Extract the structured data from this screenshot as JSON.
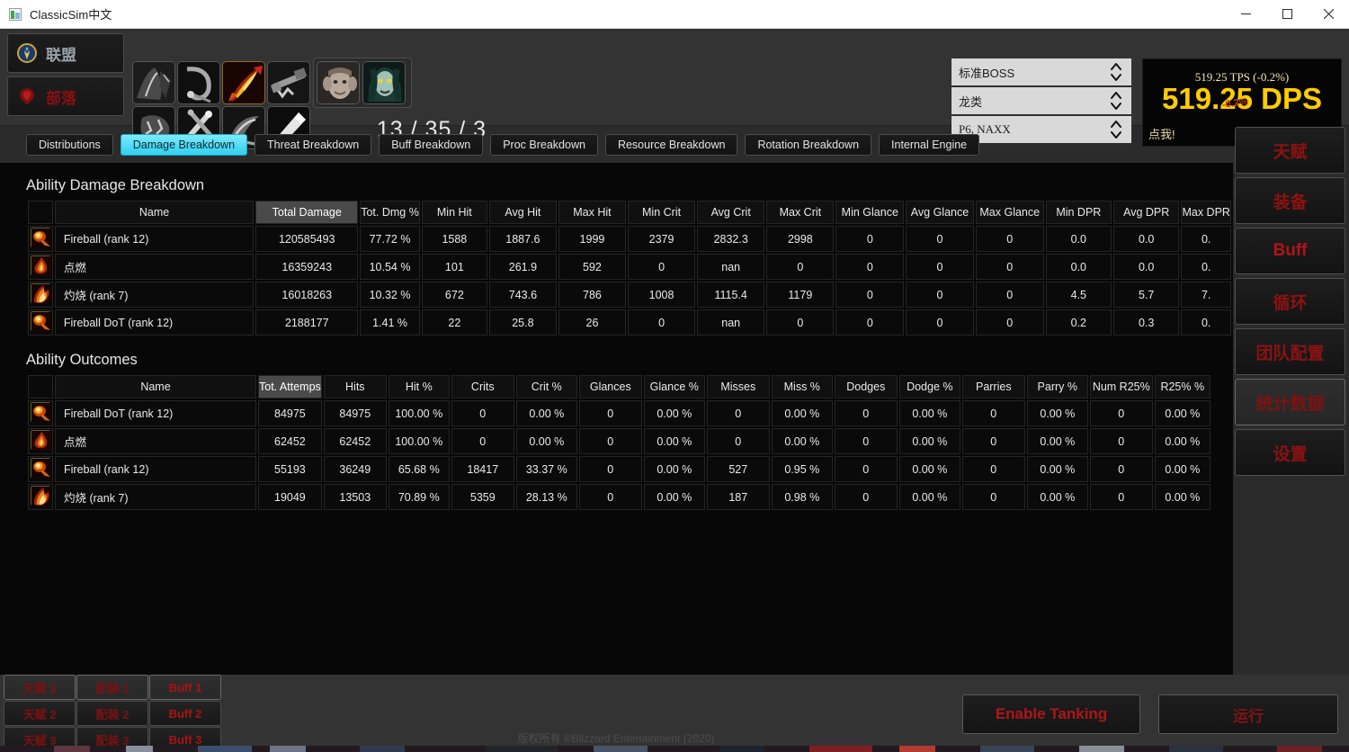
{
  "window": {
    "title": "ClassicSim中文",
    "app_icon": "app-window-icon",
    "minimize": "minimize-icon",
    "maximize": "maximize-icon",
    "close": "close-icon"
  },
  "header": {
    "factions": [
      {
        "label": "联盟",
        "icon": "alliance-crest-icon",
        "selected": false
      },
      {
        "label": "部落",
        "icon": "horde-crest-icon",
        "selected": false
      }
    ],
    "classes": [
      {
        "name": "class-icon-druid",
        "selected": false
      },
      {
        "name": "class-icon-priest",
        "selected": false
      },
      {
        "name": "class-icon-mage",
        "selected": true
      },
      {
        "name": "class-icon-hunter",
        "selected": false
      },
      {
        "name": "class-icon-shaman",
        "selected": false
      },
      {
        "name": "class-icon-rogue",
        "selected": false
      },
      {
        "name": "class-icon-warlock",
        "selected": false
      },
      {
        "name": "class-icon-warrior",
        "selected": false
      }
    ],
    "races": [
      {
        "name": "race-icon-gnome",
        "selected": false
      },
      {
        "name": "race-icon-undead",
        "selected": false
      }
    ],
    "talent_points": "13 / 35 / 3",
    "dropdowns": [
      {
        "name": "boss-select",
        "value": "标准BOSS"
      },
      {
        "name": "creature-type-select",
        "value": "龙类"
      },
      {
        "name": "phase-select",
        "value": "P6, NAXX"
      }
    ],
    "dps_panel": {
      "tps": "519.25 TPS (-0.2%)",
      "dps": "519.25 DPS",
      "dps_overlay": "-0.2%",
      "click_hint": "点我!",
      "accent": "#ffcc00"
    }
  },
  "tabs": [
    {
      "label": "Distributions",
      "active": false
    },
    {
      "label": "Damage Breakdown",
      "active": true
    },
    {
      "label": "Threat Breakdown",
      "active": false
    },
    {
      "label": "Buff Breakdown",
      "active": false
    },
    {
      "label": "Proc Breakdown",
      "active": false
    },
    {
      "label": "Resource Breakdown",
      "active": false
    },
    {
      "label": "Rotation Breakdown",
      "active": false
    },
    {
      "label": "Internal Engine",
      "active": false
    }
  ],
  "damage_breakdown": {
    "title": "Ability Damage Breakdown",
    "sorted_column": "Total Damage",
    "columns": [
      "",
      "Name",
      "Total Damage",
      "Tot. Dmg %",
      "Min Hit",
      "Avg Hit",
      "Max Hit",
      "Min Crit",
      "Avg Crit",
      "Max Crit",
      "Min Glance",
      "Avg Glance",
      "Max Glance",
      "Min DPR",
      "Avg DPR",
      "Max DPR"
    ],
    "rows": [
      {
        "icon": "ability-icon-fireball",
        "cells": [
          "Fireball (rank 12)",
          "120585493",
          "77.72 %",
          "1588",
          "1887.6",
          "1999",
          "2379",
          "2832.3",
          "2998",
          "0",
          "0",
          "0",
          "0.0",
          "0.0",
          "0."
        ]
      },
      {
        "icon": "ability-icon-ignite",
        "cells": [
          "点燃",
          "16359243",
          "10.54 %",
          "101",
          "261.9",
          "592",
          "0",
          "nan",
          "0",
          "0",
          "0",
          "0",
          "0.0",
          "0.0",
          "0."
        ]
      },
      {
        "icon": "ability-icon-scorch",
        "cells": [
          "灼烧 (rank 7)",
          "16018263",
          "10.32 %",
          "672",
          "743.6",
          "786",
          "1008",
          "1115.4",
          "1179",
          "0",
          "0",
          "0",
          "4.5",
          "5.7",
          "7."
        ]
      },
      {
        "icon": "ability-icon-fireball-dot",
        "cells": [
          "Fireball DoT (rank 12)",
          "2188177",
          "1.41 %",
          "22",
          "25.8",
          "26",
          "0",
          "nan",
          "0",
          "0",
          "0",
          "0",
          "0.2",
          "0.3",
          "0."
        ]
      }
    ]
  },
  "ability_outcomes": {
    "title": "Ability Outcomes",
    "sorted_column": "Tot. Attemps",
    "columns": [
      "",
      "Name",
      "Tot. Attemps",
      "Hits",
      "Hit %",
      "Crits",
      "Crit %",
      "Glances",
      "Glance %",
      "Misses",
      "Miss %",
      "Dodges",
      "Dodge %",
      "Parries",
      "Parry %",
      "Num R25%",
      "R25% %"
    ],
    "rows": [
      {
        "icon": "ability-icon-fireball-dot",
        "cells": [
          "Fireball DoT (rank 12)",
          "84975",
          "84975",
          "100.00 %",
          "0",
          "0.00 %",
          "0",
          "0.00 %",
          "0",
          "0.00 %",
          "0",
          "0.00 %",
          "0",
          "0.00 %",
          "0",
          "0.00 %"
        ]
      },
      {
        "icon": "ability-icon-ignite",
        "cells": [
          "点燃",
          "62452",
          "62452",
          "100.00 %",
          "0",
          "0.00 %",
          "0",
          "0.00 %",
          "0",
          "0.00 %",
          "0",
          "0.00 %",
          "0",
          "0.00 %",
          "0",
          "0.00 %"
        ]
      },
      {
        "icon": "ability-icon-fireball",
        "cells": [
          "Fireball (rank 12)",
          "55193",
          "36249",
          "65.68 %",
          "18417",
          "33.37 %",
          "0",
          "0.00 %",
          "527",
          "0.95 %",
          "0",
          "0.00 %",
          "0",
          "0.00 %",
          "0",
          "0.00 %"
        ]
      },
      {
        "icon": "ability-icon-scorch",
        "cells": [
          "灼烧 (rank 7)",
          "19049",
          "13503",
          "70.89 %",
          "5359",
          "28.13 %",
          "0",
          "0.00 %",
          "187",
          "0.98 %",
          "0",
          "0.00 %",
          "0",
          "0.00 %",
          "0",
          "0.00 %"
        ]
      }
    ]
  },
  "sidebar": {
    "items": [
      {
        "label": "天赋",
        "active": false,
        "english": false
      },
      {
        "label": "装备",
        "active": false,
        "english": false
      },
      {
        "label": "Buff",
        "active": false,
        "english": true
      },
      {
        "label": "循环",
        "active": false,
        "english": false
      },
      {
        "label": "团队配置",
        "active": false,
        "english": false
      },
      {
        "label": "统计数据",
        "active": true,
        "english": false
      },
      {
        "label": "设置",
        "active": false,
        "english": false
      }
    ]
  },
  "bottom": {
    "presets": [
      {
        "label": "天赋 1",
        "active": true
      },
      {
        "label": "配装 1",
        "active": true
      },
      {
        "label": "Buff 1",
        "active": true,
        "english": true
      },
      {
        "label": "天赋 2",
        "active": false
      },
      {
        "label": "配装 2",
        "active": false
      },
      {
        "label": "Buff 2",
        "active": false,
        "english": true
      },
      {
        "label": "天赋 3",
        "active": false
      },
      {
        "label": "配装 3",
        "active": false
      },
      {
        "label": "Buff 3",
        "active": false,
        "english": true
      }
    ],
    "enable_tanking": "Enable Tanking",
    "run": "运行",
    "footer": "版权所有 ©Blizzard Entertainment (2020)"
  },
  "colors": {
    "tab_active": "#2fd0ef",
    "dps_yellow": "#ffcc00",
    "red_text": "#8c1212",
    "panel_bg": "#070707"
  }
}
